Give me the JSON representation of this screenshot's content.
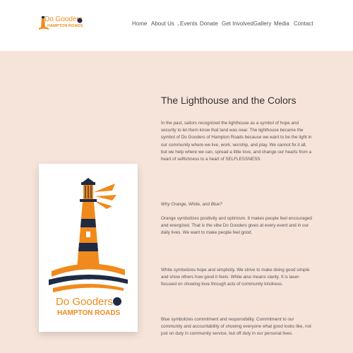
{
  "header": {
    "logo": {
      "line1": "Do Gooders",
      "line2": "HAMPTON ROADS"
    },
    "nav": [
      {
        "label": "Home",
        "name": "nav-home"
      },
      {
        "label": "About Us",
        "name": "nav-about-us",
        "dropdown": true
      },
      {
        "label": "Events",
        "name": "nav-events"
      },
      {
        "label": "Donate",
        "name": "nav-donate"
      },
      {
        "label": "Get Involved",
        "name": "nav-get-involved"
      },
      {
        "label": "Gallery",
        "name": "nav-gallery"
      },
      {
        "label": "Media",
        "name": "nav-media"
      },
      {
        "label": "Contact",
        "name": "nav-contact"
      }
    ]
  },
  "colors": {
    "orange": "#f08a1c",
    "navy": "#1f2a44",
    "background": "#f6e4da"
  },
  "main": {
    "title": "The Lighthouse and the Colors",
    "intro": "In the past, sailors recognized the lighthouse as a symbol of hope and security to let them know that land was near. The lighthouse became the symbol of Do Gooders of Hampton Roads because we want to be the light in our community where we live, work, worship, and play. We cannot fix it all, but we help where we can, spread a little love, and change our hearts from a heart of selfishness to a heart of SELFLESSNESS.",
    "question": "Why Orange, White, and Blue?",
    "orange": "Orange symbolizes positivity and optimism.  It makes people feel encouraged and energized.  That is the vibe Do Gooders gives at every event and in our daily lives.  We want to make people feel good.",
    "white": "White symbolizes hope and simplicity.  We strive to make doing good simple and show others how good it feels.  White also means clarity. It is laser-focused on showing love through acts of community kindness.",
    "blue": "Blue symbolizes commitment and responsibility. Commitment to our community and accountability of showing everyone what good looks like, not just on duty in community service, but off duty in our personal lives.",
    "card_logo": {
      "line1": "Do Gooders",
      "line2": "HAMPTON ROADS"
    }
  }
}
